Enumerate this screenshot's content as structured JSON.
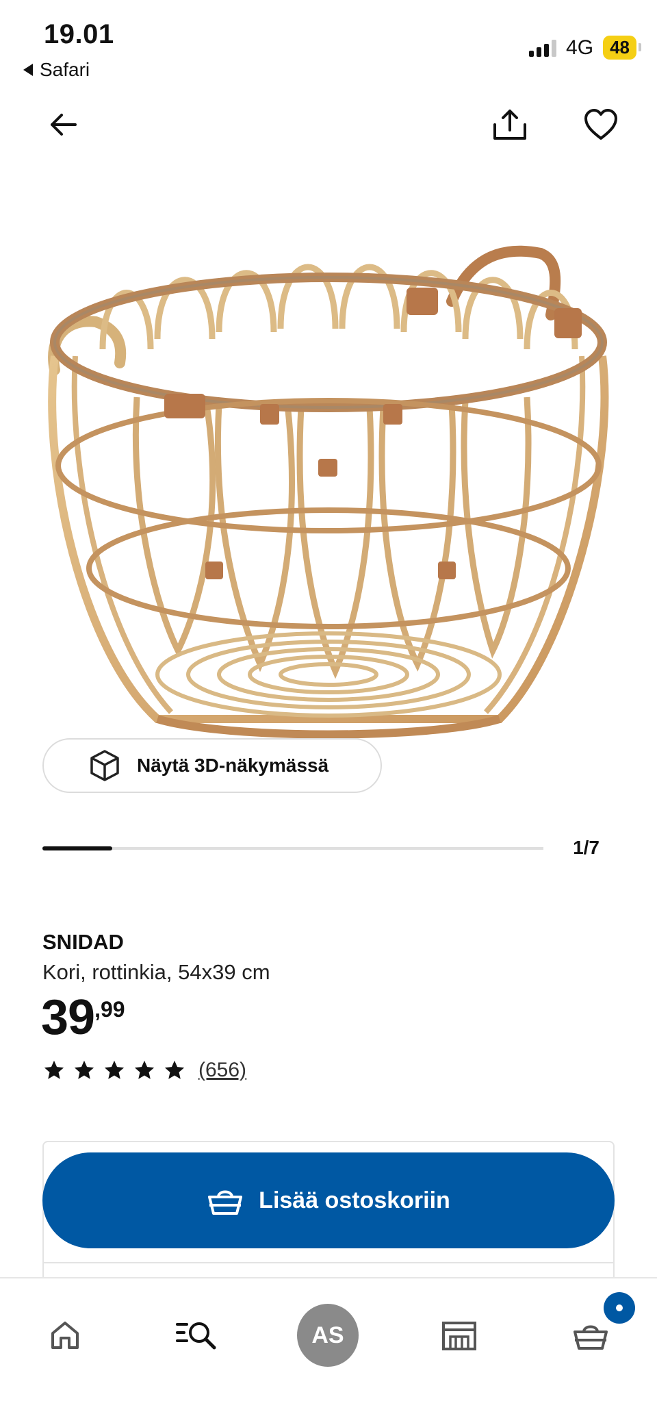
{
  "status_bar": {
    "time": "19.01",
    "back_app": "Safari",
    "network": "4G",
    "battery": "48"
  },
  "nav": {
    "back_icon": "arrow-left-icon",
    "share_icon": "share-icon",
    "favorite_icon": "heart-icon"
  },
  "gallery": {
    "view3d_label": "Näytä 3D-näkymässä",
    "pager": "1/7",
    "progress": 0.14
  },
  "product": {
    "name": "SNIDAD",
    "description": "Kori, rottinkia, 54x39 cm",
    "price_int": "39",
    "price_dec": ",99",
    "rating_stars": 5,
    "review_count": "(656)"
  },
  "actions": {
    "add_to_cart": "Lisää ostoskoriin"
  },
  "tabbar": {
    "avatar_initials": "AS",
    "items": [
      "home-icon",
      "search-icon",
      "profile-avatar",
      "store-icon",
      "cart-icon"
    ]
  },
  "colors": {
    "accent": "#0058a3",
    "battery": "#f5cf14",
    "avatar": "#8a8a8a"
  }
}
